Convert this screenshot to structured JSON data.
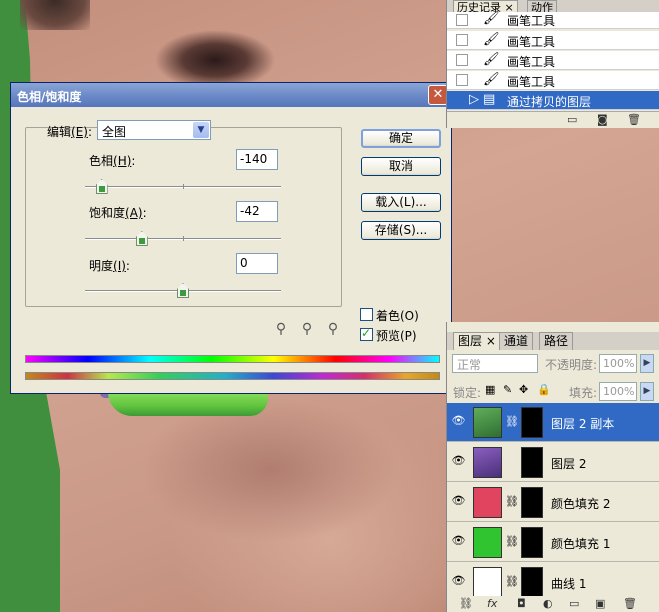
{
  "dialog": {
    "title": "色相/饱和度",
    "close_glyph": "✕",
    "edit_label": "编辑",
    "edit_hotkey": "(E)",
    "edit_colon": ":",
    "edit_value": "全图",
    "hue": {
      "label": "色相",
      "hotkey": "(H)",
      "colon": ":",
      "value": "-140",
      "slider_fraction": 0.085
    },
    "saturation": {
      "label": "饱和度",
      "hotkey": "(A)",
      "colon": ":",
      "value": "-42",
      "slider_fraction": 0.29
    },
    "lightness": {
      "label": "明度",
      "hotkey": "(I)",
      "colon": ":",
      "value": "0",
      "slider_fraction": 0.5
    },
    "buttons": {
      "ok": "确定",
      "cancel": "取消",
      "load": "载入(L)...",
      "save": "存储(S)..."
    },
    "colorize": {
      "label": "着色(O)",
      "checked": false
    },
    "preview": {
      "label": "预览(P)",
      "checked": true
    }
  },
  "history": {
    "tabs": [
      "历史记录",
      "动作"
    ],
    "tab_close": "×",
    "items": [
      {
        "label": "画笔工具",
        "icon": "brush-icon",
        "selected": false
      },
      {
        "label": "画笔工具",
        "icon": "brush-icon",
        "selected": false
      },
      {
        "label": "画笔工具",
        "icon": "brush-icon",
        "selected": false
      },
      {
        "label": "画笔工具",
        "icon": "brush-icon",
        "selected": false
      },
      {
        "label": "通过拷贝的图层",
        "icon": "layer-copy-icon",
        "selected": true
      }
    ]
  },
  "layers_panel": {
    "tabs": [
      "图层",
      "通道",
      "路径"
    ],
    "tab_close": "×",
    "blend_mode": "正常",
    "opacity_label": "不透明度:",
    "opacity_value": "100%",
    "lock_label": "锁定:",
    "fill_label": "填充:",
    "fill_value": "100%",
    "layers": [
      {
        "name": "图层 2 副本",
        "thumb_color": "#3f8f3e",
        "selected": true
      },
      {
        "name": "图层 2",
        "thumb_color": "#6a4fa8",
        "selected": false
      },
      {
        "name": "颜色填充 2",
        "thumb_color": "#e0445e",
        "selected": false
      },
      {
        "name": "颜色填充 1",
        "thumb_color": "#31c431",
        "selected": false
      },
      {
        "name": "曲线 1",
        "thumb_color": "#ffffff",
        "selected": false
      }
    ]
  },
  "colors": {
    "dialog_bg": "#ece9d8",
    "titlebar": "#6d8bc8",
    "selection": "#316ac5",
    "green_screen": "#3f8f3e"
  }
}
